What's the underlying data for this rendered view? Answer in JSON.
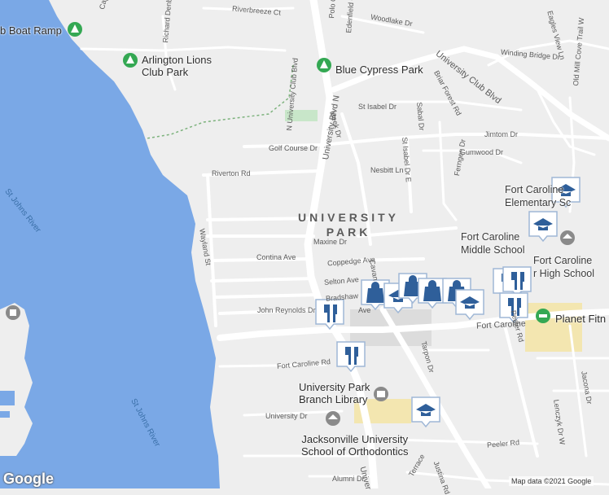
{
  "map": {
    "colors": {
      "water": "#7aa8e6",
      "land": "#eeeeee",
      "road": "#ffffff",
      "poi_green": "#34a853",
      "marker": "#2f5f9a",
      "school_area": "#f3e6b0"
    },
    "area_label": "UNIVERSITY\nPARK",
    "pois": [
      {
        "id": "boat-ramp",
        "label": "b Boat Ramp",
        "icon": "park-icon"
      },
      {
        "id": "arlington-lions",
        "label": "Arlington Lions\nClub Park",
        "icon": "park-icon"
      },
      {
        "id": "blue-cypress",
        "label": "Blue Cypress Park",
        "icon": "park-icon"
      },
      {
        "id": "fort-caroline-elem",
        "label": "Fort Caroline\nElementary Sc",
        "icon": "school-icon"
      },
      {
        "id": "fort-caroline-middle",
        "label": "Fort Caroline\nMiddle School",
        "icon": "school-icon"
      },
      {
        "id": "fort-caroline-high",
        "label": "Fort Caroline\nr High School",
        "icon": "school-icon"
      },
      {
        "id": "planet-fitness",
        "label": "Planet Fitn",
        "icon": "gym-icon"
      },
      {
        "id": "library",
        "label": "University Park\nBranch Library",
        "icon": "book-icon"
      },
      {
        "id": "orthodontics",
        "label": "Jacksonville University\nSchool of Orthodontics",
        "icon": "school-icon"
      }
    ],
    "water_labels": [
      "St Johns River",
      "St Johns River"
    ],
    "streets": [
      "Cape Sable",
      "Richard Denby",
      "Riverbreeze Ct",
      "Polo Ct",
      "Edenfield Ct",
      "Woodlake Dr",
      "Eagles View Ln",
      "Winding Bridge Dr",
      "University Club Blvd",
      "Briar Forest Rd",
      "N University Club Blvd",
      "St Isabel Dr",
      "Sabal Dr",
      "Old Mill Cove Trail W",
      "Jimtom Dr",
      "Meek Dr",
      "University Blvd N",
      "Golf Course Dr",
      "Gumwood Dr",
      "Nesbitt Ln",
      "St Isabel Dr E",
      "Riverton Rd",
      "Ferngen Dr",
      "Wayland St",
      "Maxine Dr",
      "Contina Ave",
      "Coppedge Ave",
      "Cavan",
      "Selton Ave",
      "Bradshaw",
      "John Reynolds Dr",
      "Ave",
      "Fort Caroline",
      "Peeler Rd",
      "Fort Caroline Rd",
      "Tarpon Dr",
      "Jacona Dr",
      "Lenczyk Dr W",
      "University Dr",
      "Peeler Rd",
      "Alumni Dr",
      "Justina Rd",
      "Univer",
      "Terrace"
    ],
    "footer": {
      "attribution": "Map data ©2021 Google",
      "logo": "Google"
    }
  }
}
